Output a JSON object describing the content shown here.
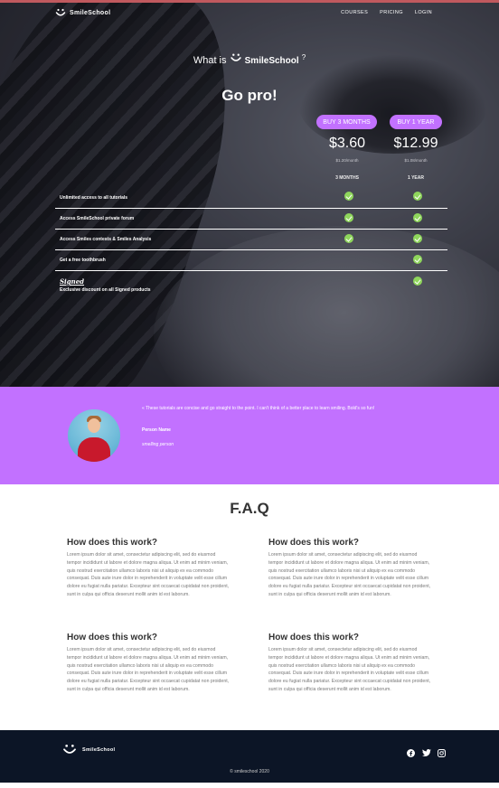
{
  "brand": {
    "name": "SmileSchool"
  },
  "nav": {
    "links": [
      "COURSES",
      "PRICING",
      "LOGIN"
    ]
  },
  "hero": {
    "what_is": "What is",
    "question_mark": "?",
    "title": "Go pro!"
  },
  "plans": [
    {
      "button": "BUY 3 MONTHS",
      "price": "$3.60",
      "per_month": "$1.20/month",
      "column_header": "3 MONTHS"
    },
    {
      "button": "BUY 1 YEAR",
      "price": "$12.99",
      "per_month": "$1.08/month",
      "column_header": "1 YEAR"
    }
  ],
  "features": [
    {
      "label": "Unlimited access to all tutorials",
      "plan_3m": true,
      "plan_1y": true
    },
    {
      "label": "Access SmileSchool private forum",
      "plan_3m": true,
      "plan_1y": true
    },
    {
      "label": "Access Smiles contests & Smiles Analysis",
      "plan_3m": true,
      "plan_1y": true
    },
    {
      "label": "Get a free toothbrush",
      "plan_3m": false,
      "plan_1y": true
    }
  ],
  "signed": {
    "logo_text": "Signed",
    "label": "Exclusive discount on all Signed products",
    "plan_3m": false,
    "plan_1y": true
  },
  "quote": {
    "text": "« These tutorials are concise and go straight to the point. I can't think of a better place to learn smiling. Bold's so fun!",
    "name": "Person Name",
    "role": "smelling person"
  },
  "faq": {
    "title": "F.A.Q",
    "items": [
      {
        "question": "How does this work?",
        "answer": "Lorem ipsum dolor sit amet, consectetur adipiscing elit, sed do eiusmod tempor incididunt ut labore et dolore magna aliqua. Ut enim ad minim veniam, quis nostrud exercitation ullamco laboris nisi ut aliquip ex ea commodo consequat. Duis aute irure dolor in reprehenderit in voluptate velit esse cillum dolore eu fugiat nulla pariatur. Excepteur sint occaecat cupidatat non proident, sunt in culpa qui officia deserunt mollit anim id est laborum."
      },
      {
        "question": "How does this work?",
        "answer": "Lorem ipsum dolor sit amet, consectetur adipiscing elit, sed do eiusmod tempor incididunt ut labore et dolore magna aliqua. Ut enim ad minim veniam, quis nostrud exercitation ullamco laboris nisi ut aliquip ex ea commodo consequat. Duis aute irure dolor in reprehenderit in voluptate velit esse cillum dolore eu fugiat nulla pariatur. Excepteur sint occaecat cupidatat non proident, sunt in culpa qui officia deserunt mollit anim id est laborum."
      },
      {
        "question": "How does this work?",
        "answer": "Lorem ipsum dolor sit amet, consectetur adipiscing elit, sed do eiusmod tempor incididunt ut labore et dolore magna aliqua. Ut enim ad minim veniam, quis nostrud exercitation ullamco laboris nisi ut aliquip ex ea commodo consequat. Duis aute irure dolor in reprehenderit in voluptate velit esse cillum dolore eu fugiat nulla pariatur. Excepteur sint occaecat cupidatat non proident, sunt in culpa qui officia deserunt mollit anim id est laborum."
      },
      {
        "question": "How does this work?",
        "answer": "Lorem ipsum dolor sit amet, consectetur adipiscing elit, sed do eiusmod tempor incididunt ut labore et dolore magna aliqua. Ut enim ad minim veniam, quis nostrud exercitation ullamco laboris nisi ut aliquip ex ea commodo consequat. Duis aute irure dolor in reprehenderit in voluptate velit esse cillum dolore eu fugiat nulla pariatur. Excepteur sint occaecat cupidatat non proident, sunt in culpa qui officia deserunt mollit anim id est laborum."
      }
    ]
  },
  "footer": {
    "copyright": "© smileschool 2020",
    "social_icons": [
      "facebook-icon",
      "twitter-icon",
      "instagram-icon"
    ]
  },
  "colors": {
    "accent": "#c271ff",
    "check": "#8fd65c",
    "footer_bg": "#0c1526",
    "top_line": "#c0595e"
  }
}
